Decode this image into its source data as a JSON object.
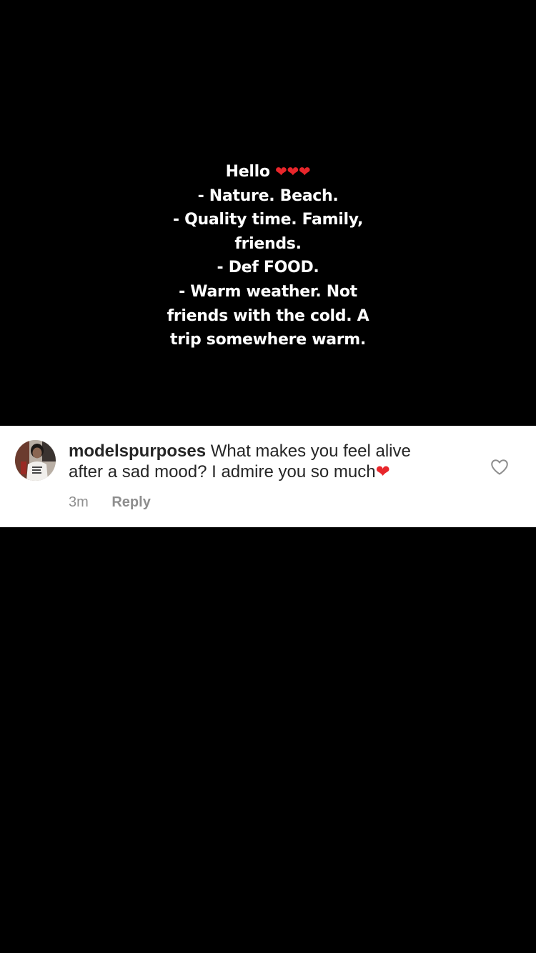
{
  "story": {
    "greeting": "Hello",
    "greeting_hearts": "❤❤❤",
    "lines": [
      "- Nature. Beach.",
      "- Quality time. Family,",
      "friends.",
      "- Def FOOD.",
      "- Warm weather. Not",
      "friends with the cold. A",
      "trip somewhere warm."
    ]
  },
  "comment": {
    "username": "modelspurposes",
    "text_line1": "What makes you feel alive",
    "text_line2": "after a sad mood? I admire you so much",
    "heart_emoji": "❤",
    "time": "3m",
    "reply_label": "Reply",
    "like_icon": "heart-outline-icon"
  },
  "colors": {
    "background": "#000000",
    "story_text": "#ffffff",
    "heart_red": "#e8262b",
    "card_background": "#ffffff",
    "meta_gray": "#8e8e8e"
  }
}
